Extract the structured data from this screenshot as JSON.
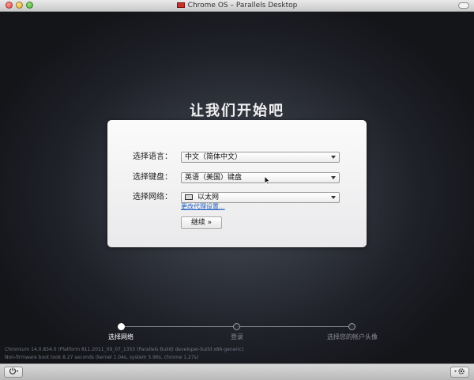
{
  "window": {
    "title": "Chrome OS – Parallels Desktop"
  },
  "main": {
    "heading": "让我们开始吧",
    "language": {
      "label": "选择语言：",
      "value": "中文（简体中文）"
    },
    "keyboard": {
      "label": "选择键盘：",
      "value": "英语（美国）键盘"
    },
    "network": {
      "label": "选择网络：",
      "value": "以太网",
      "icon": "ethernet-icon"
    },
    "proxy_link": "更改代理设置...",
    "continue_label": "继续 »"
  },
  "steps": [
    {
      "label": "选择网络",
      "active": true
    },
    {
      "label": "登录",
      "active": false
    },
    {
      "label": "选择您的帐户头像",
      "active": false
    }
  ],
  "info": {
    "version": "Chromium 14.0.834.0 (Platform 811.2011_09_07_1355 (Parallels Build) developer-build x86-generic)",
    "boot": "Non-firmware boot took 8.27 seconds (kernel 1.04s, system 5.96s, chrome 1.27s)"
  },
  "bottombar": {
    "power_icon": "power-icon",
    "settings_icon": "gear-icon"
  },
  "colors": {
    "card_bg": "#f4f4f6",
    "link": "#1f5fbf",
    "background": "#1f2129"
  }
}
